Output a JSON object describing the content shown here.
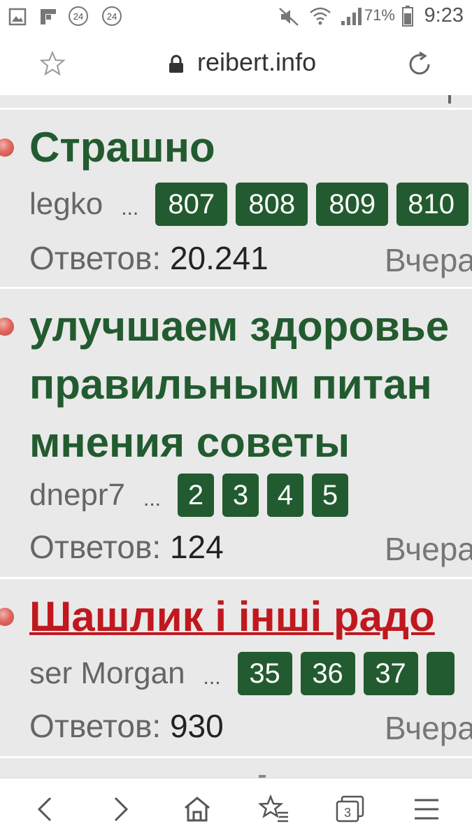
{
  "status_bar": {
    "notif_badge_1": "24",
    "notif_badge_2": "24",
    "battery": "71%",
    "time": "9:23"
  },
  "browser": {
    "url": "reibert.info",
    "tab_count": "3"
  },
  "threads": [
    {
      "title": "Страшно",
      "author": "legko",
      "ellipsis": "...",
      "pages": [
        "807",
        "808",
        "809",
        "810"
      ],
      "replies_label": "Ответов:",
      "replies": "20.241",
      "last": "Вчера"
    },
    {
      "title_lines": [
        "улучшаем здоровье",
        "правильным питан",
        "мнения советы"
      ],
      "author": "dnepr7",
      "ellipsis": "...",
      "pages": [
        "2",
        "3",
        "4",
        "5"
      ],
      "replies_label": "Ответов:",
      "replies": "124",
      "last": "Вчера"
    },
    {
      "title": "Шашлик і інші радо",
      "author": "ser Morgan",
      "ellipsis": "...",
      "pages": [
        "35",
        "36",
        "37"
      ],
      "replies_label": "Ответов:",
      "replies": "930",
      "last": "Вчера"
    }
  ],
  "colors": {
    "accent_green": "#225b2f",
    "unread_red": "#c0181e",
    "background": "#e9e9e9"
  }
}
